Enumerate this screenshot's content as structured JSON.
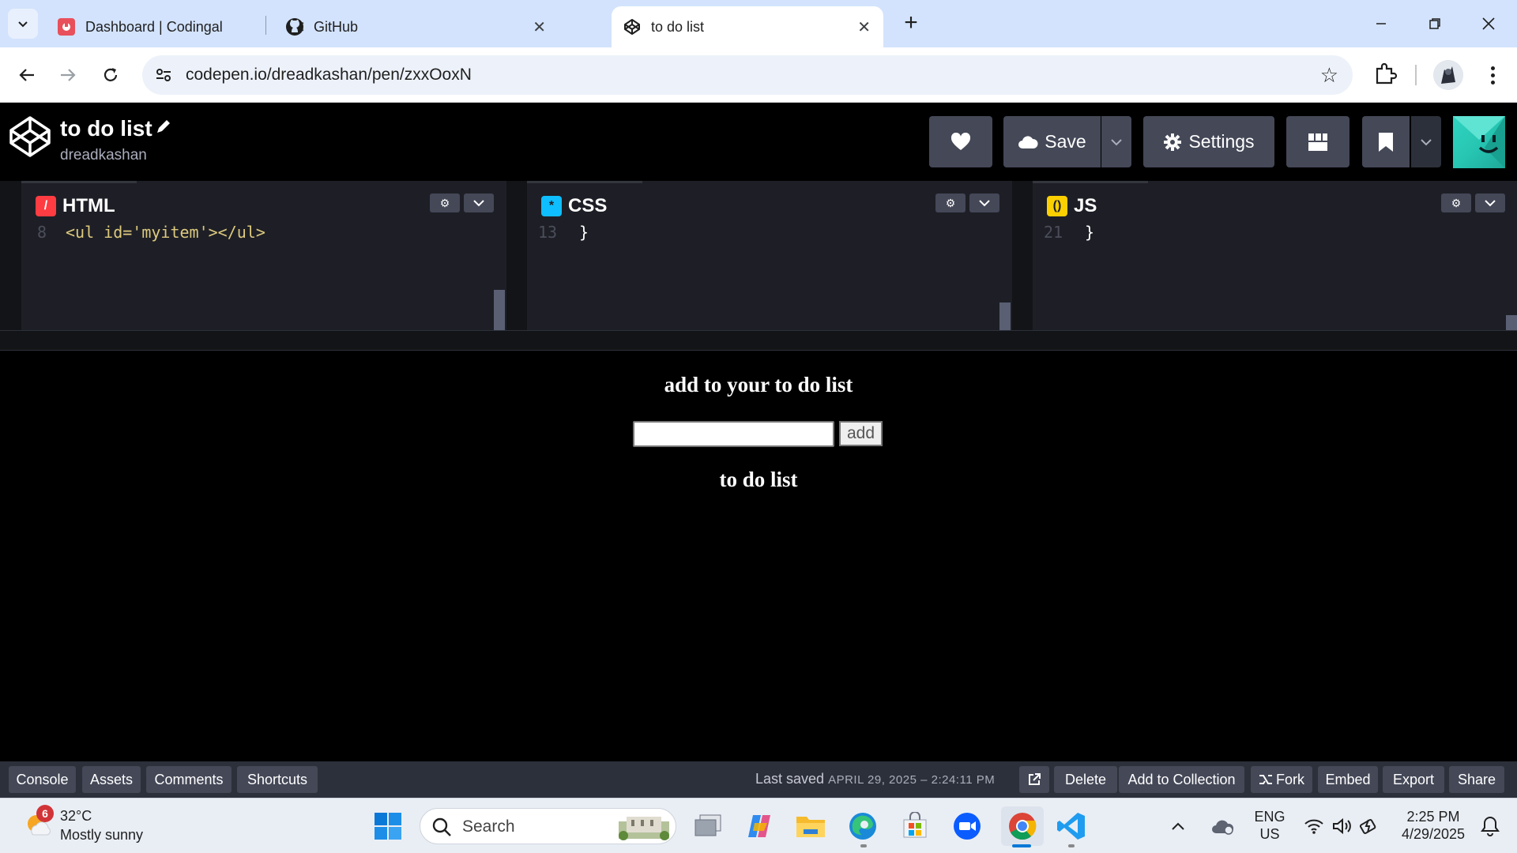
{
  "browser": {
    "tabs": [
      {
        "title": "Dashboard | Codingal",
        "active": false
      },
      {
        "title": "GitHub",
        "active": false
      },
      {
        "title": "to do list",
        "active": true
      }
    ],
    "url": "codepen.io/dreadkashan/pen/zxxOoxN"
  },
  "codepen": {
    "pen_title": "to do list",
    "username": "dreadkashan",
    "save_label": "Save",
    "settings_label": "Settings",
    "editors": [
      {
        "name": "HTML",
        "line": "8",
        "code": "<ul id='myitem'></ul>",
        "accent": "#ff3c41"
      },
      {
        "name": "CSS",
        "line": "13",
        "code": "}",
        "accent": "#0ebeff"
      },
      {
        "name": "JS",
        "line": "21",
        "code": "}",
        "accent": "#fcd000"
      }
    ]
  },
  "preview": {
    "heading": "add to your to do list",
    "input_value": "",
    "add_button": "add",
    "list_heading": "to do list"
  },
  "footer": {
    "left_buttons": [
      "Console",
      "Assets",
      "Comments",
      "Shortcuts"
    ],
    "last_saved_label": "Last saved",
    "last_saved_date": "APRIL 29, 2025 – 2:24:11 PM",
    "right_buttons": [
      "Delete",
      "Add to Collection",
      "Fork",
      "Embed",
      "Export",
      "Share"
    ]
  },
  "taskbar": {
    "weather_badge": "6",
    "temperature": "32°C",
    "condition": "Mostly sunny",
    "search_placeholder": "Search",
    "lang_line1": "ENG",
    "lang_line2": "US",
    "time": "2:25 PM",
    "date": "4/29/2025"
  }
}
